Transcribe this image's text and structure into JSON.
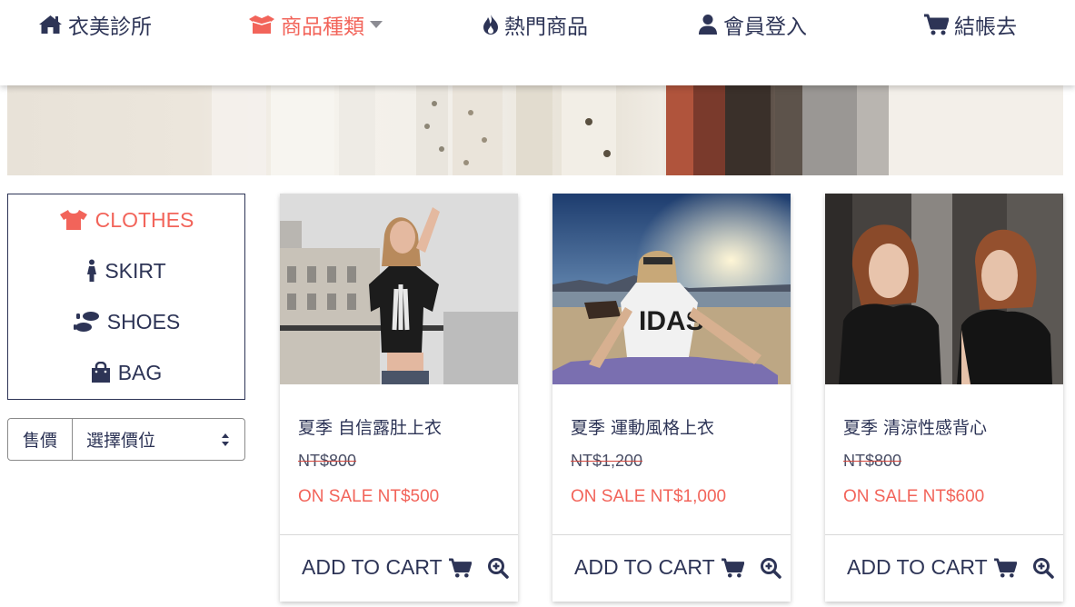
{
  "nav": {
    "items": [
      {
        "label": "衣美診所",
        "icon": "home-icon"
      },
      {
        "label": "商品種類",
        "icon": "box-open-icon",
        "active": true
      },
      {
        "label": "熱門商品",
        "icon": "fire-icon"
      },
      {
        "label": "會員登入",
        "icon": "user-icon"
      },
      {
        "label": "結帳去",
        "icon": "cart-icon"
      }
    ]
  },
  "categories": [
    {
      "label": "CLOTHES",
      "icon": "tshirt-icon",
      "active": true
    },
    {
      "label": "SKIRT",
      "icon": "female-icon"
    },
    {
      "label": "SHOES",
      "icon": "shoe-prints-icon"
    },
    {
      "label": "BAG",
      "icon": "shopping-bag-icon"
    }
  ],
  "price_filter": {
    "label": "售價",
    "selected": "選擇價位"
  },
  "products": [
    {
      "title": "夏季 自信露肚上衣",
      "original_price": "NT$800",
      "sale_price": "ON SALE NT$500",
      "add_label": "ADD TO CART"
    },
    {
      "title": "夏季 運動風格上衣",
      "original_price": "NT$1,200",
      "sale_price": "ON SALE NT$1,000",
      "add_label": "ADD TO CART"
    },
    {
      "title": "夏季 清涼性感背心",
      "original_price": "NT$800",
      "sale_price": "ON SALE NT$600",
      "add_label": "ADD TO CART"
    }
  ],
  "colors": {
    "accent": "#f2645a",
    "navy": "#2d3456"
  }
}
